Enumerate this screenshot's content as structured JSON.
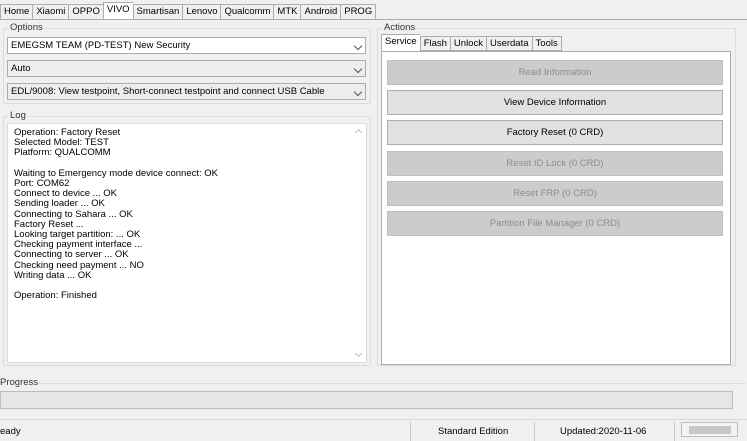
{
  "top_tabs": [
    "Home",
    "Xiaomi",
    "OPPO",
    "VIVO",
    "Smartisan",
    "Lenovo",
    "Qualcomm",
    "MTK",
    "Android",
    "PROG"
  ],
  "active_top_tab": "VIVO",
  "options": {
    "title": "Options",
    "model_select": "EMEGSM TEAM (PD-TEST) New Security",
    "mode_select": "Auto",
    "edl_select": "EDL/9008: View testpoint, Short-connect testpoint and connect USB Cable"
  },
  "log": {
    "title": "Log",
    "lines": [
      "Operation: Factory Reset",
      "Selected Model: TEST",
      "Platform: QUALCOMM",
      "",
      "Waiting to Emergency mode device connect: OK",
      "Port: COM62",
      "Connect to device ... OK",
      "Sending loader ... OK",
      "Connecting to Sahara ... OK",
      "Factory Reset ...",
      "Looking target partition: ... OK",
      "Checking payment interface ...",
      "Connecting to server ... OK",
      "Checking need payment ... NO",
      "Writing data ... OK",
      "",
      "Operation: Finished"
    ]
  },
  "actions": {
    "title": "Actions",
    "tabs": [
      "Service",
      "Flash",
      "Unlock",
      "Userdata",
      "Tools"
    ],
    "active_tab": "Service",
    "buttons": [
      {
        "label": "Read Information",
        "enabled": false
      },
      {
        "label": "View Device Information",
        "enabled": true
      },
      {
        "label": "Factory Reset (0 CRD)",
        "enabled": true
      },
      {
        "label": "Reset ID Lock (0 CRD)",
        "enabled": false
      },
      {
        "label": "Reset FRP (0 CRD)",
        "enabled": false
      },
      {
        "label": "Partition File Manager (0 CRD)",
        "enabled": false
      }
    ]
  },
  "progress": {
    "title": "Progress",
    "value": 0
  },
  "status_bar": {
    "state": "eady",
    "edition": "Standard Edition",
    "updated": "Updated:2020-11-06"
  }
}
